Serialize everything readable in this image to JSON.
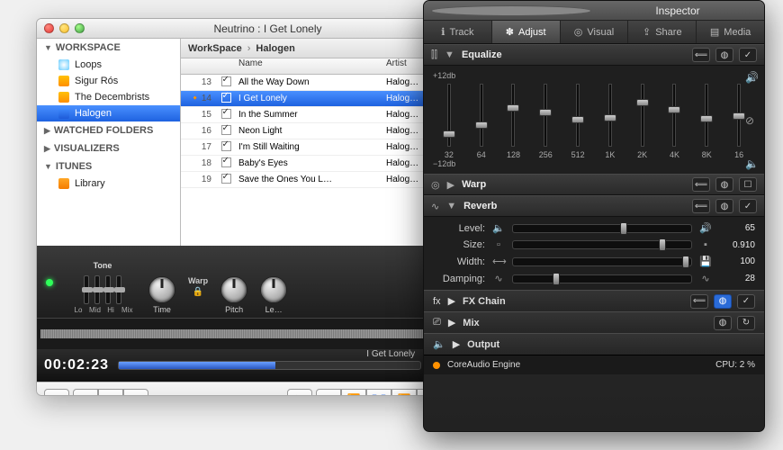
{
  "main": {
    "title": "Neutrino : I Get Lonely",
    "sidebar": {
      "workspace": {
        "label": "WORKSPACE",
        "items": [
          {
            "label": "Loops"
          },
          {
            "label": "Sigur Rós"
          },
          {
            "label": "The Decembrists"
          },
          {
            "label": "Halogen"
          }
        ]
      },
      "watched": {
        "label": "WATCHED FOLDERS"
      },
      "visualizers": {
        "label": "VISUALIZERS"
      },
      "itunes": {
        "label": "ITUNES",
        "items": [
          {
            "label": "Library"
          }
        ]
      }
    },
    "crumbs": {
      "root": "WorkSpace",
      "leaf": "Halogen"
    },
    "columns": {
      "name": "Name",
      "artist": "Artist"
    },
    "tracks": [
      {
        "n": "13",
        "name": "All the Way Down",
        "artist": "Halog…"
      },
      {
        "n": "14",
        "name": "I Get Lonely",
        "artist": "Halog…"
      },
      {
        "n": "15",
        "name": "In the Summer",
        "artist": "Halog…"
      },
      {
        "n": "16",
        "name": "Neon Light",
        "artist": "Halog…"
      },
      {
        "n": "17",
        "name": "I'm Still Waiting",
        "artist": "Halog…"
      },
      {
        "n": "18",
        "name": "Baby's Eyes",
        "artist": "Halog…"
      },
      {
        "n": "19",
        "name": "Save the Ones You L…",
        "artist": "Halog…"
      }
    ],
    "tone": {
      "label": "Tone",
      "axis": [
        "Lo",
        "Mid",
        "Hi",
        "Mix"
      ]
    },
    "knobs": {
      "warp_label": "Warp",
      "time": "Time",
      "pitch": "Pitch",
      "level": "Le…"
    },
    "timecode": "00:02:23",
    "nowplaying": "I Get Lonely"
  },
  "inspector": {
    "title": "Inspector",
    "tabs": [
      {
        "icon": "ℹ",
        "label": "Track"
      },
      {
        "icon": "✽",
        "label": "Adjust"
      },
      {
        "icon": "◎",
        "label": "Visual"
      },
      {
        "icon": "⇪",
        "label": "Share"
      },
      {
        "icon": "▤",
        "label": "Media"
      }
    ],
    "eq": {
      "name": "Equalize",
      "top": "+12db",
      "bottom": "−12db",
      "bands": [
        {
          "f": "32",
          "pos": 75
        },
        {
          "f": "64",
          "pos": 60
        },
        {
          "f": "128",
          "pos": 32
        },
        {
          "f": "256",
          "pos": 40
        },
        {
          "f": "512",
          "pos": 52
        },
        {
          "f": "1K",
          "pos": 48
        },
        {
          "f": "2K",
          "pos": 24
        },
        {
          "f": "4K",
          "pos": 36
        },
        {
          "f": "8K",
          "pos": 50
        },
        {
          "f": "16",
          "pos": 46
        }
      ]
    },
    "warp": {
      "name": "Warp"
    },
    "reverb": {
      "name": "Reverb",
      "params": [
        {
          "label": "Level:",
          "pre": "🔈",
          "post": "🔊",
          "val": "65",
          "pos": 60
        },
        {
          "label": "Size:",
          "pre": "▫",
          "post": "▪",
          "val": "0.910",
          "pos": 82
        },
        {
          "label": "Width:",
          "pre": "⟷",
          "post": "💾",
          "val": "100",
          "pos": 95
        },
        {
          "label": "Damping:",
          "pre": "∿",
          "post": "∿",
          "val": "28",
          "pos": 22
        }
      ]
    },
    "fxchain": {
      "name": "FX Chain"
    },
    "mix": {
      "name": "Mix"
    },
    "output": {
      "name": "Output"
    },
    "status": {
      "engine": "CoreAudio Engine",
      "cpu": "CPU: 2 %"
    }
  }
}
